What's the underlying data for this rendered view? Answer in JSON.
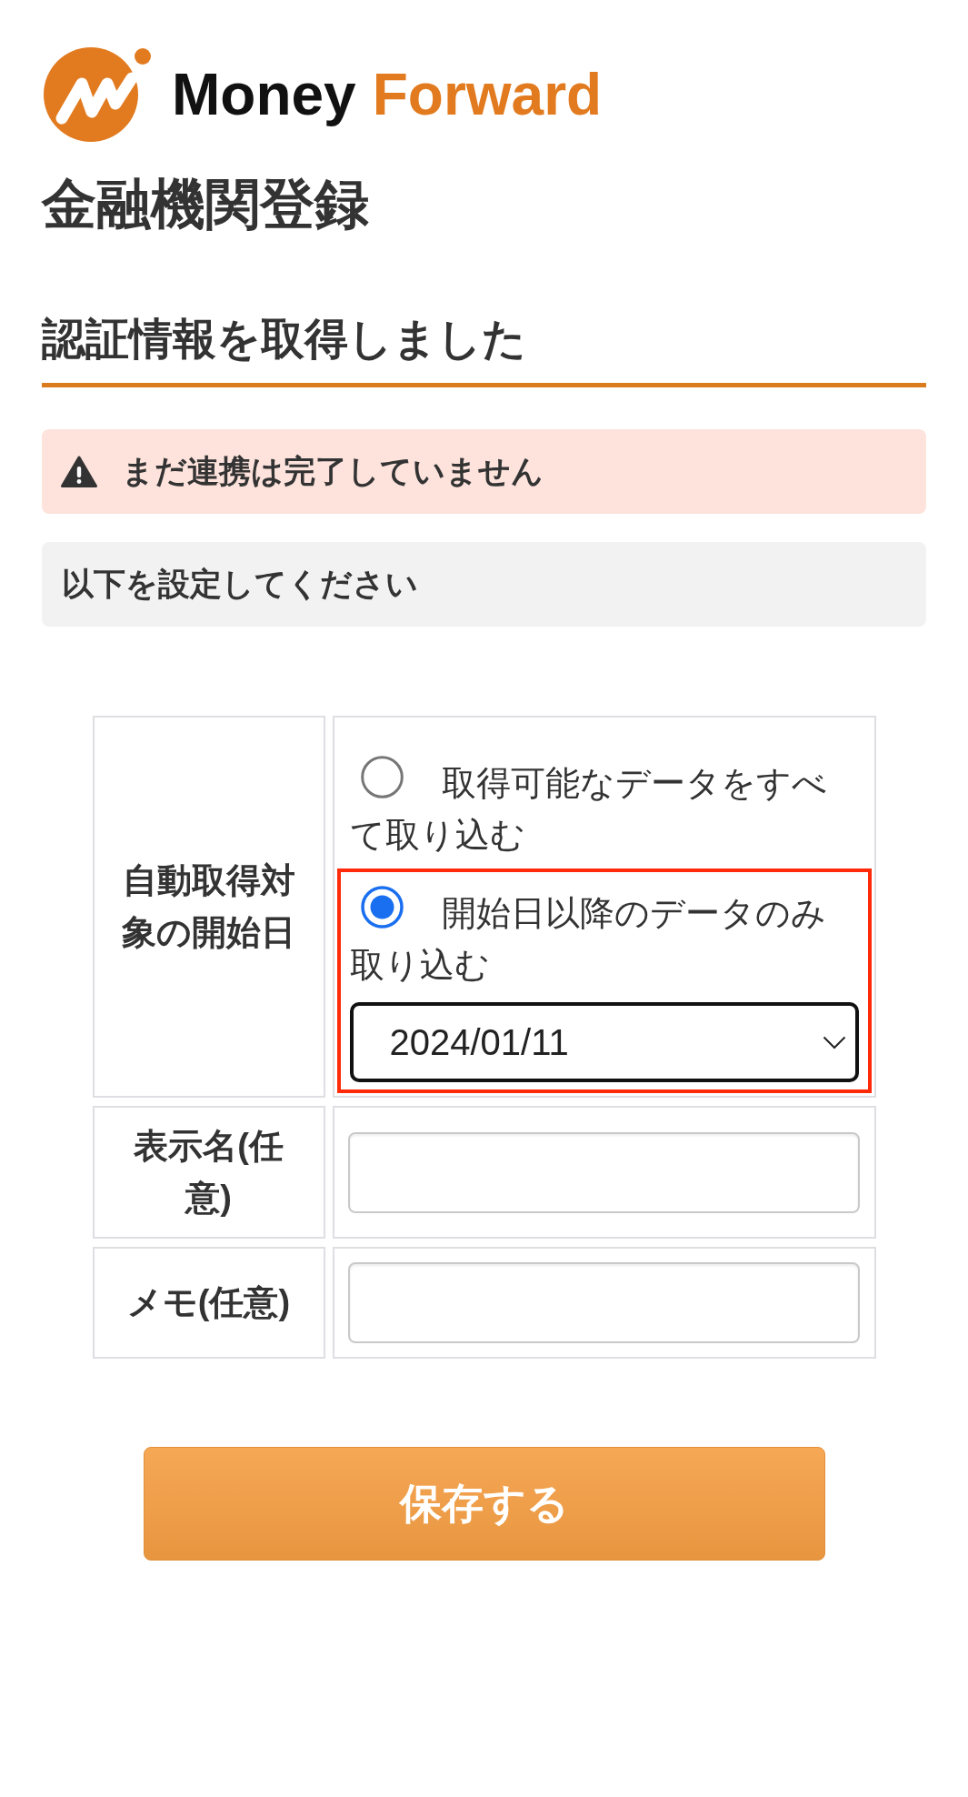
{
  "logo": {
    "words": [
      {
        "text": "Money",
        "color": "#111111"
      },
      {
        "text": "Forward",
        "color": "#e27b1f"
      }
    ]
  },
  "page_title": "金融機関登録",
  "section_heading": "認証情報を取得しました",
  "alerts": [
    {
      "kind": "warning",
      "text": "まだ連携は完了していません"
    },
    {
      "kind": "info",
      "text": "以下を設定してください"
    }
  ],
  "settings_table": {
    "rows": [
      {
        "kind": "radio_group",
        "label": "自動取得対象の開始日",
        "options": [
          {
            "label": "取得可能なデータをすべて取り込む",
            "selected": false,
            "highlighted": false
          },
          {
            "label": "開始日以降のデータのみ取り込む",
            "selected": true,
            "highlighted": true,
            "date_select": {
              "value": "2024/01/11"
            }
          }
        ]
      },
      {
        "kind": "text_field",
        "label": "表示名(任意)"
      },
      {
        "kind": "text_field",
        "label": "メモ(任意)"
      }
    ]
  },
  "save_button": {
    "label": "保存する"
  }
}
